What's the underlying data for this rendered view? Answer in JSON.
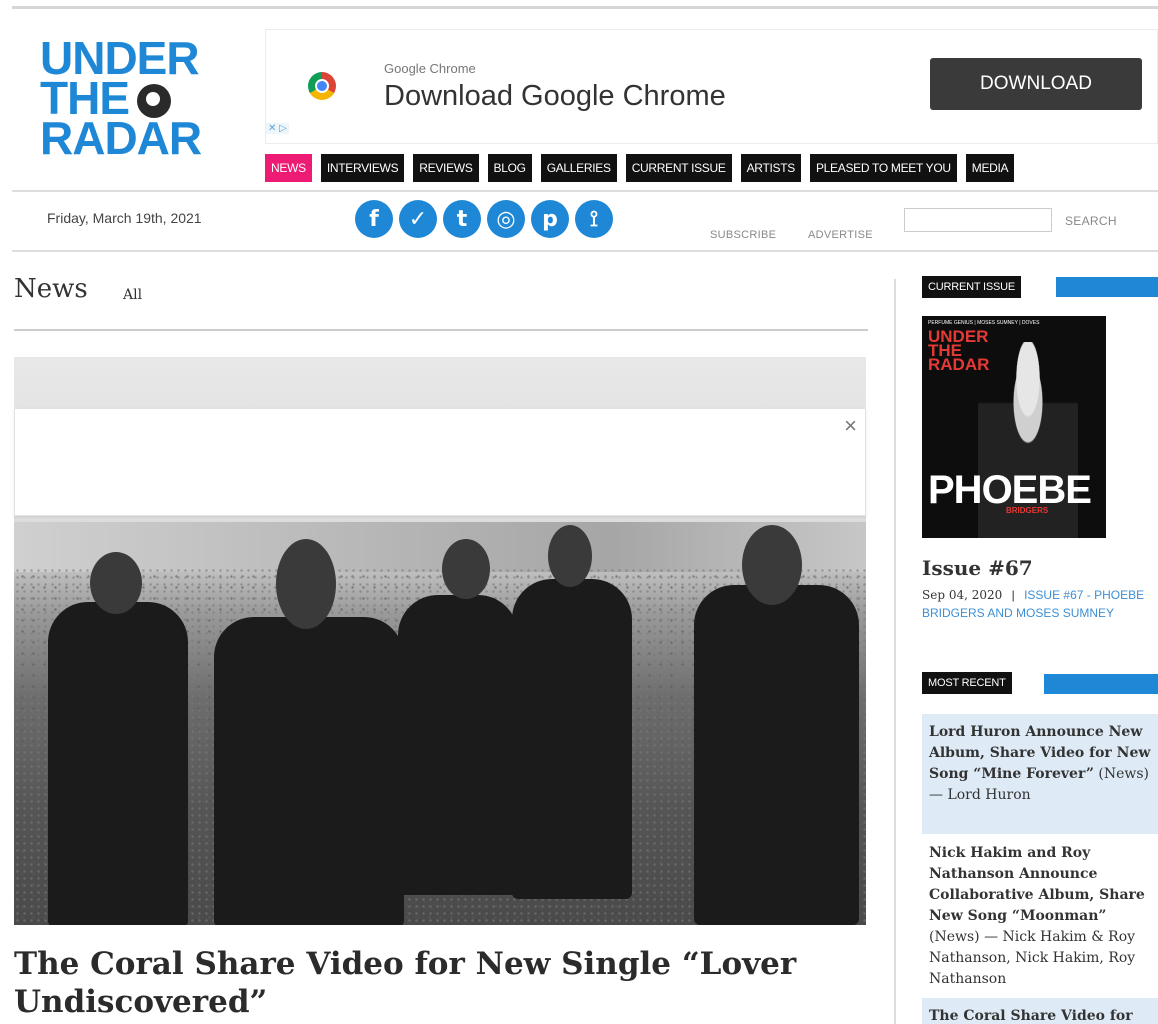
{
  "logo": {
    "line1": "UNDER",
    "line2": "THE",
    "line3": "RADAR"
  },
  "ad": {
    "small_text": "Google Chrome",
    "title": "Download Google Chrome",
    "button": "DOWNLOAD",
    "choices": "✕ ▷"
  },
  "nav": {
    "items": [
      "NEWS",
      "INTERVIEWS",
      "REVIEWS",
      "BLOG",
      "GALLERIES",
      "CURRENT ISSUE",
      "ARTISTS",
      "PLEASED TO MEET YOU",
      "MEDIA"
    ],
    "active": "NEWS"
  },
  "utility": {
    "date": "Friday, March 19th, 2021",
    "social": [
      {
        "icon": "facebook-icon",
        "glyph": "f"
      },
      {
        "icon": "twitter-icon",
        "glyph": "✓"
      },
      {
        "icon": "tumblr-icon",
        "glyph": "t"
      },
      {
        "icon": "instagram-icon",
        "glyph": "◎"
      },
      {
        "icon": "pinterest-icon",
        "glyph": "p"
      },
      {
        "icon": "rss-icon",
        "glyph": "⟟"
      }
    ],
    "subscribe": "SUBSCRIBE",
    "advertise": "ADVERTISE",
    "search_placeholder": "",
    "search_button": "SEARCH"
  },
  "main": {
    "heading": "News",
    "filter": "All",
    "overlay_close": "×",
    "article_title": "The Coral Share Video for New Single “Lover Undiscovered”"
  },
  "sidebar": {
    "current_issue_label": "CURRENT ISSUE",
    "cover": {
      "top_text": "PERFUME GENIUS | MOSES SUMNEY | DOVES",
      "logo_line1": "UNDER",
      "logo_line2": "THE",
      "logo_line3": "RADAR",
      "name": "PHOEBE",
      "sub": "BRIDGERS"
    },
    "issue_title": "Issue #67",
    "issue_date": "Sep 04, 2020",
    "issue_sep": "|",
    "issue_link": "ISSUE #67 - PHOEBE BRIDGERS AND MOSES SUMNEY",
    "most_recent_label": "MOST RECENT",
    "recent": [
      {
        "title": "Lord Huron Announce New Album, Share Video for New Song “Mine Forever”",
        "meta": " (News) — Lord Huron"
      },
      {
        "title": "Nick Hakim and Roy Nathanson Announce Collaborative Album, Share New Song “Moonman”",
        "meta": " (News) — Nick Hakim & Roy Nathanson, Nick Hakim, Roy Nathanson"
      },
      {
        "title": "The Coral Share Video for",
        "meta": ""
      }
    ]
  },
  "colors": {
    "brand_blue": "#1e88d6",
    "nav_active": "#ee1b74",
    "nav_bg": "#111111",
    "recent_shade": "#deebf6"
  }
}
